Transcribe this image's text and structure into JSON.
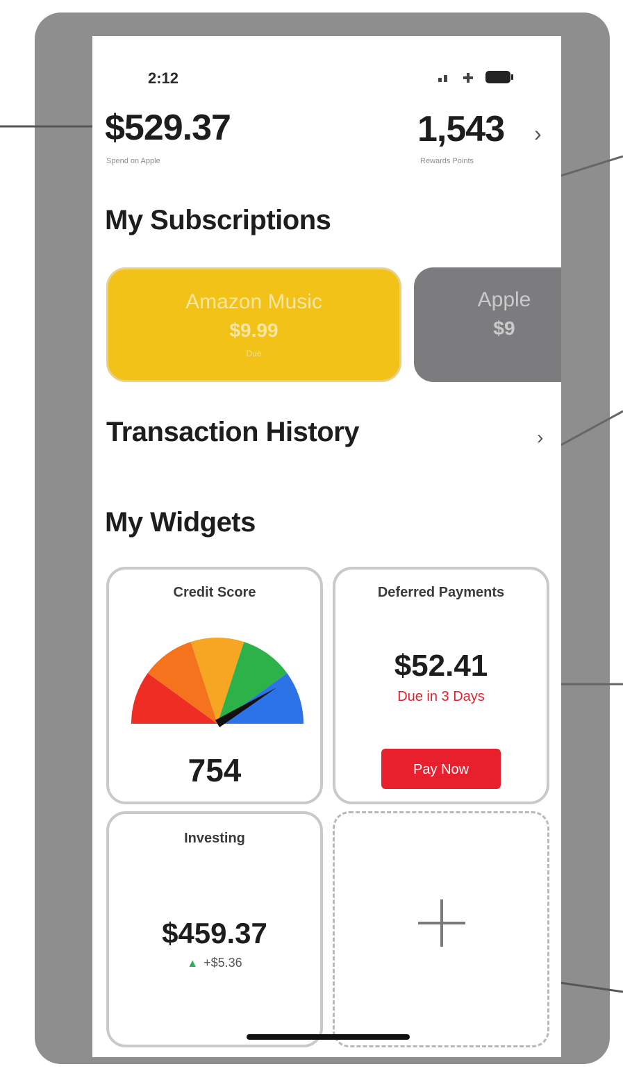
{
  "status_bar": {
    "time": "2:12"
  },
  "header": {
    "balance": "$529.37",
    "balance_caption": "Spend on Apple",
    "points": "1,543",
    "points_caption": "Rewards Points"
  },
  "subscriptions": {
    "title": "My Subscriptions",
    "cards": [
      {
        "name": "Amazon Music",
        "price": "$9.99",
        "note": "Due",
        "color": "#f2c218"
      },
      {
        "name": "Apple",
        "price": "$9",
        "note": "",
        "color": "#7c7c7e"
      }
    ]
  },
  "transactions": {
    "title": "Transaction History"
  },
  "widgets": {
    "title": "My Widgets",
    "credit_score": {
      "label": "Credit Score",
      "value": "754",
      "score": 754
    },
    "deferred_payments": {
      "label": "Deferred Payments",
      "amount": "$52.41",
      "due": "Due in 3 Days",
      "button": "Pay Now"
    },
    "investing": {
      "label": "Investing",
      "amount": "$459.37",
      "change": "+$5.36"
    },
    "add_widget": {
      "icon": "plus-icon"
    }
  },
  "colors": {
    "accent_yellow": "#f2c218",
    "accent_red": "#e8202e",
    "positive_green": "#2fae5a",
    "gauge": [
      "#ee2d24",
      "#f5731c",
      "#f6a623",
      "#2db24a",
      "#2d73e8"
    ]
  }
}
